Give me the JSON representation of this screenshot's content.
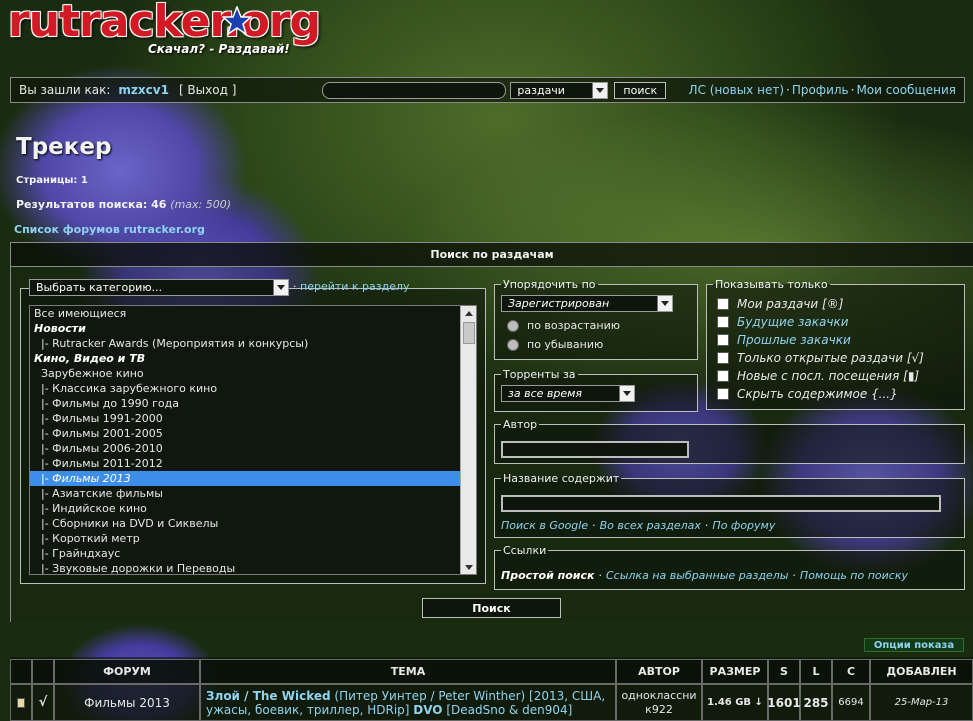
{
  "logo": {
    "brand": "rutracker.org",
    "slogan": "Скачал? - Раздавай!"
  },
  "topbar": {
    "logged_in_as": "Вы зашли как:",
    "username": "mzxcv1",
    "logout": "[ Выход ]",
    "search_placeholder": "",
    "search_scope": "раздачи",
    "search_button": "поиск",
    "pm": "ЛС (новых нет)",
    "profile": "Профиль",
    "my_messages": "Мои сообщения"
  },
  "page": {
    "title": "Трекер",
    "pages": "Страницы:  1",
    "results_label": "Результатов поиска: 46",
    "results_max": "(max: 500)",
    "forums_link": "Список форумов rutracker.org"
  },
  "search_panel": {
    "heading": "Поиск по раздачам",
    "category_select": "Выбрать категорию...",
    "goto_section": "перейти к разделу",
    "categories": [
      {
        "label": "Все имеющиеся",
        "style": "normal"
      },
      {
        "label": "Новости",
        "style": "bold"
      },
      {
        "label": "  |- Rutracker Awards (Мероприятия и конкурсы)",
        "style": "normal"
      },
      {
        "label": "Кино, Видео и ТВ",
        "style": "bold"
      },
      {
        "label": "  Зарубежное кино",
        "style": "normal"
      },
      {
        "label": "  |- Классика зарубежного кино",
        "style": "normal"
      },
      {
        "label": "  |- Фильмы до 1990 года",
        "style": "normal"
      },
      {
        "label": "  |- Фильмы 1991-2000",
        "style": "normal"
      },
      {
        "label": "  |- Фильмы 2001-2005",
        "style": "normal"
      },
      {
        "label": "  |- Фильмы 2006-2010",
        "style": "normal"
      },
      {
        "label": "  |- Фильмы 2011-2012",
        "style": "normal"
      },
      {
        "label": "  |- Фильмы 2013",
        "style": "selected"
      },
      {
        "label": "  |- Азиатские фильмы",
        "style": "normal"
      },
      {
        "label": "  |- Индийское кино",
        "style": "normal"
      },
      {
        "label": "  |- Сборники на DVD и Сиквелы",
        "style": "normal"
      },
      {
        "label": "  |- Короткий метр",
        "style": "normal"
      },
      {
        "label": "  |- Грайндхаус",
        "style": "normal"
      },
      {
        "label": "  |- Звуковые дорожки и Переводы",
        "style": "normal"
      }
    ],
    "order_legend": "Упорядочить по",
    "order_value": "Зарегистрирован",
    "asc": "по возрастанию",
    "desc": "по убыванию",
    "period_legend": "Торренты за",
    "period_value": "за все время",
    "show_legend": "Показывать только",
    "show_options": [
      {
        "label": "Мои раздачи [®]",
        "link": false
      },
      {
        "label": "Будущие закачки",
        "link": true
      },
      {
        "label": "Прошлые закачки",
        "link": true
      },
      {
        "label": "Только открытые раздачи  [√]",
        "link": false
      },
      {
        "label": "Новые с посл. посещения [▮]",
        "link": false
      },
      {
        "label": "Скрыть содержимое {...}",
        "link": false
      }
    ],
    "author_legend": "Автор",
    "title_legend": "Название содержит",
    "title_links": [
      "Поиск в Google",
      "Во всех разделах",
      "По форуму"
    ],
    "links_legend": "Ссылки",
    "simple_search": "Простой поиск",
    "link_selected": "Ссылка на выбранные разделы",
    "search_help": "Помощь по поиску",
    "search_button": "Поиск"
  },
  "results": {
    "options_button": "Опции показа",
    "headers": {
      "forum": "ФОРУМ",
      "topic": "ТЕМА",
      "author": "АВТОР",
      "size": "РАЗМЕР",
      "s": "S",
      "l": "L",
      "c": "C",
      "added": "ДОБАВЛЕН"
    },
    "rows": [
      {
        "checked": "√",
        "forum": "Фильмы 2013",
        "title": "Злой / The Wicked",
        "info": " (Питер Уинтер / Peter Winther) [2013, США, ужасы, боевик, триллер, HDRip] ",
        "dvo": "DVO",
        "extra": " [DeadSno & den904]",
        "author": "одноклассни к922",
        "size": "1.46 GB ↓",
        "seeds": "1601",
        "leech": "285",
        "completed": "6694",
        "added": "25-Мар-13"
      }
    ]
  },
  "colors": {
    "link": "#8fd3f0",
    "selected": "#3d8ee8",
    "logo_red": "#d21a25"
  }
}
